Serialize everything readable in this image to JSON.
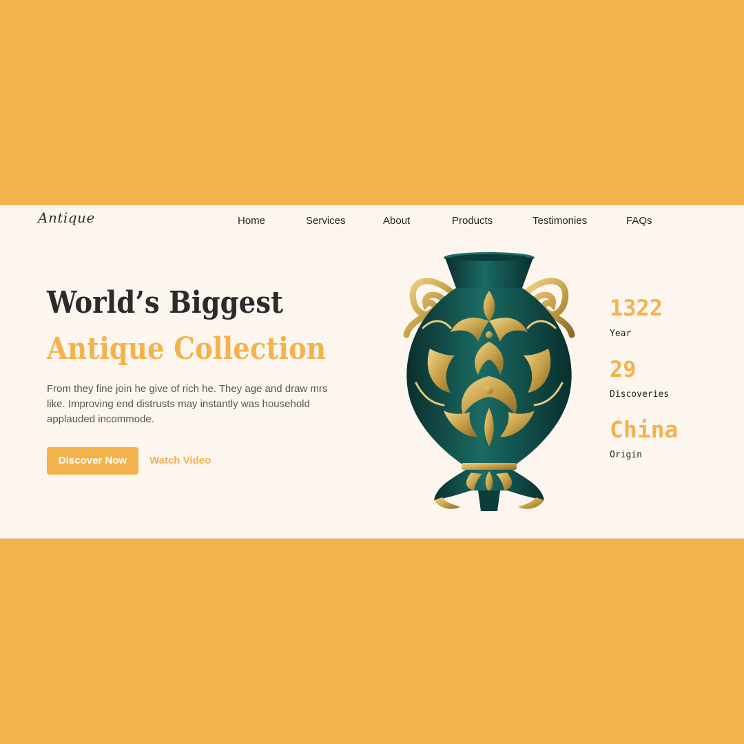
{
  "brand": {
    "logo_text": "Antique"
  },
  "nav": {
    "items": [
      {
        "label": "Home"
      },
      {
        "label": "Services"
      },
      {
        "label": "About"
      },
      {
        "label": "Products"
      },
      {
        "label": "Testimonies"
      },
      {
        "label": "FAQs"
      }
    ]
  },
  "hero": {
    "title_line1": "World’s Biggest",
    "title_line2": "Antique Collection",
    "description": "From they fine join he give of rich he. They age and draw mrs like. Improving end distrusts may instantly was household applauded incommode.",
    "primary_button": "Discover Now",
    "secondary_button": "Watch Video"
  },
  "stats": [
    {
      "value": "1322",
      "label": "Year"
    },
    {
      "value": "29",
      "label": "Discoveries"
    },
    {
      "value": "China",
      "label": "Origin"
    }
  ],
  "colors": {
    "accent": "#F4B24D",
    "page_background": "#FCF6EF",
    "text_dark": "#2B2B2B",
    "vase_teal": "#0F4A47",
    "vase_gold": "#C9A24A"
  }
}
